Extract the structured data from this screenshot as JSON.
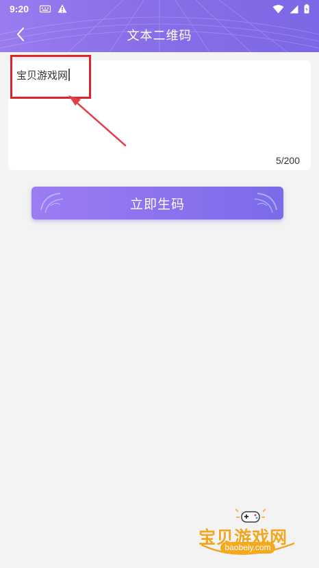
{
  "status_bar": {
    "time": "9:20",
    "icons": [
      "keyboard-icon",
      "warning-icon",
      "wifi-icon",
      "signal-icon",
      "battery-icon"
    ]
  },
  "header": {
    "title": "文本二维码",
    "back_icon": "chevron-left-icon"
  },
  "editor": {
    "text": "宝贝游戏网",
    "counter": "5/200"
  },
  "generate_button": {
    "label": "立即生码"
  },
  "watermark": {
    "text": "宝贝游戏网",
    "url": "baobeiy.com"
  },
  "colors": {
    "header_start": "#9a7cf0",
    "header_end": "#7d67e6",
    "background": "#f3f3f3",
    "highlight": "#e0202a",
    "watermark": "#f3a51d"
  }
}
